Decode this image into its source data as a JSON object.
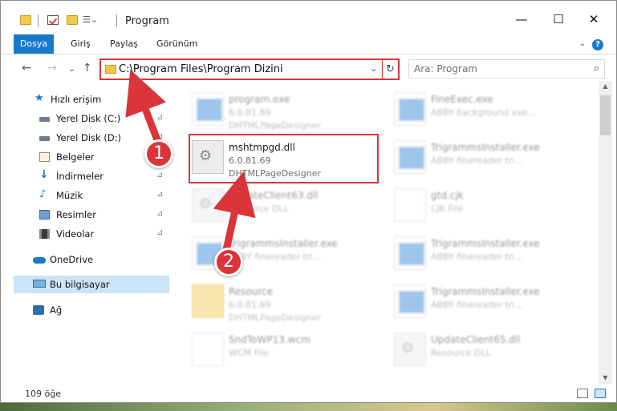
{
  "window": {
    "title": "Program",
    "minimize": "—",
    "maximize": "☐",
    "close": "✕"
  },
  "ribbon": {
    "tabs": [
      {
        "label": "Dosya"
      },
      {
        "label": "Giriş"
      },
      {
        "label": "Paylaş"
      },
      {
        "label": "Görünüm"
      }
    ],
    "help": "?",
    "collapse": "⌄"
  },
  "address": {
    "path": "C:\\Program Files\\Program Dizini",
    "dropdown": "⌄",
    "refresh": "↻"
  },
  "nav": {
    "back": "←",
    "forward": "→",
    "recent": "⌄",
    "up": "↑"
  },
  "search": {
    "placeholder": "Ara: Program",
    "icon": "⌕"
  },
  "sidebar": {
    "items": [
      {
        "label": "Hızlı erişim",
        "icon": "star-icon"
      },
      {
        "label": "Yerel Disk (C:)",
        "icon": "drive-icon"
      },
      {
        "label": "Yerel Disk (D:)",
        "icon": "drive-icon"
      },
      {
        "label": "Belgeler",
        "icon": "documents-icon"
      },
      {
        "label": "İndirmeler",
        "icon": "download-icon"
      },
      {
        "label": "Müzik",
        "icon": "music-icon"
      },
      {
        "label": "Resimler",
        "icon": "pictures-icon"
      },
      {
        "label": "Videolar",
        "icon": "videos-icon"
      },
      {
        "label": "OneDrive",
        "icon": "cloud-icon"
      },
      {
        "label": "Bu bilgisayar",
        "icon": "computer-icon"
      },
      {
        "label": "Ağ",
        "icon": "network-icon"
      }
    ],
    "pin": "📌"
  },
  "files": {
    "left": [
      {
        "name": "program.exe",
        "line1": "6.0.81.69",
        "line2": "DHTMLPageDesigner"
      },
      {
        "name": "mshtmpgd.dll",
        "line1": "6.0.81.69",
        "line2": "DHTMLPageDesigner"
      },
      {
        "name": "UpdateClient63.dll",
        "line1": "Resource DLL",
        "line2": ""
      },
      {
        "name": "TrigrammsInstaller.exe",
        "line1": "ABBY finereader tri...",
        "line2": ""
      },
      {
        "name": "Resource",
        "line1": "6.0.81.69",
        "line2": "DHTMLPageDesigner"
      },
      {
        "name": "SndToWP13.wcm",
        "line1": "WCM File",
        "line2": ""
      }
    ],
    "right": [
      {
        "name": "FineExec.exe",
        "line1": "ABBY background exe...",
        "line2": ""
      },
      {
        "name": "TrigrammsInstaller.exe",
        "line1": "ABBY finereader tri...",
        "line2": ""
      },
      {
        "name": "gtd.cjk",
        "line1": "CJK File",
        "line2": ""
      },
      {
        "name": "TrigrammsInstaller.exe",
        "line1": "ABBY finereader tri...",
        "line2": ""
      },
      {
        "name": "TrigrammsInstaller.exe",
        "line1": "ABBY finereader tri...",
        "line2": ""
      },
      {
        "name": "UpdateClient65.dll",
        "line1": "Resource DLL",
        "line2": ""
      }
    ]
  },
  "status": {
    "count": "109 öğe"
  },
  "annotations": {
    "badge1": "1",
    "badge2": "2",
    "color": "#d9353b"
  }
}
